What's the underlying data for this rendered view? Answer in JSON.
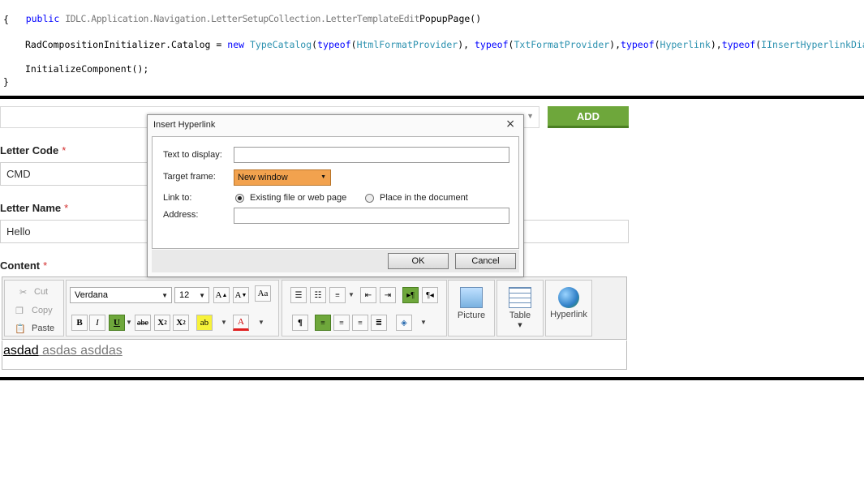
{
  "code": {
    "line1_kw": "public",
    "line1_blur": "IDLC.Application.Navigation.LetterSetupCollection.LetterTemplateEdit",
    "line1_rest": "PopupPage()",
    "line2": "{",
    "line3_a": "RadCompositionInitializer",
    "line3_b": ".Catalog = ",
    "line3_new": "new",
    "line3_type": "TypeCatalog",
    "line3_c": "(",
    "line3_typeof1": "typeof",
    "line3_t1": "HtmlFormatProvider",
    "line3_typeof2": "typeof",
    "line3_t2": "TxtFormatProvider",
    "line3_typeof3": "typeof",
    "line3_t3": "Hyperlink",
    "line3_typeof4": "typeof",
    "line3_t4": "IInsertHyperlinkDialog",
    "line4": "InitializeComponent();",
    "line5": "}"
  },
  "form": {
    "add_label": "ADD",
    "letter_code_label": "Letter Code",
    "letter_code_value": "CMD",
    "letter_name_label": "Letter Name",
    "letter_name_value": "Hello",
    "content_label": "Content",
    "required_mark": "*"
  },
  "toolbar": {
    "cut": "Cut",
    "copy": "Copy",
    "paste": "Paste",
    "font_family": "Verdana",
    "font_size": "12",
    "bold": "B",
    "italic": "I",
    "underline": "U",
    "strike": "abe",
    "paragraph": "¶",
    "picture": "Picture",
    "table": "Table",
    "hyperlink": "Hyperlink"
  },
  "editor": {
    "text_a": "asdad",
    "text_b": " asdas asddas"
  },
  "dialog": {
    "title": "Insert Hyperlink",
    "close": "×",
    "text_to_display_label": "Text to display:",
    "text_to_display_value": "",
    "target_frame_label": "Target frame:",
    "target_frame_value": "New window",
    "link_to_label": "Link to:",
    "option_existing": "Existing file or web page",
    "option_place": "Place in the document",
    "address_label": "Address:",
    "address_value": "",
    "ok": "OK",
    "cancel": "Cancel"
  },
  "colors": {
    "accent_green": "#6ea73b",
    "target_frame_orange": "#f2a24e",
    "required_red": "#d32f2f"
  }
}
